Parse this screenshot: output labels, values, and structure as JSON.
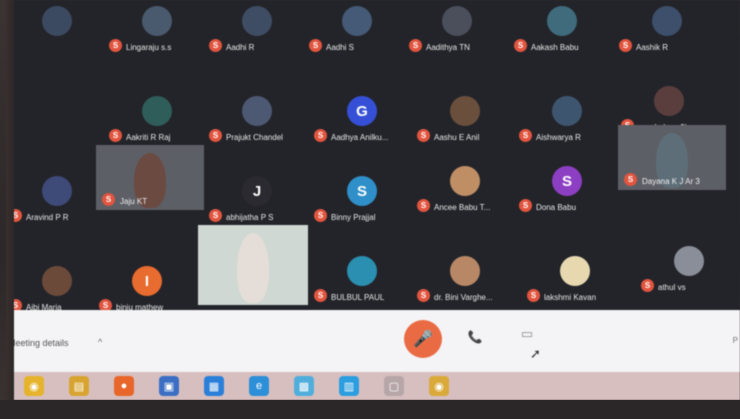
{
  "participants": [
    {
      "name": "Lingaraju s.s",
      "initial": "",
      "avatar_color": "#4a5a6e"
    },
    {
      "name": "Aadhi R",
      "initial": "",
      "avatar_color": "#3e4d63"
    },
    {
      "name": "Aadhi S",
      "initial": "",
      "avatar_color": "#455a76"
    },
    {
      "name": "Aadithya TN",
      "initial": "",
      "avatar_color": "#4b4f5c"
    },
    {
      "name": "Aakash Babu",
      "initial": "",
      "avatar_color": "#3f6b7d"
    },
    {
      "name": "Aashik R",
      "initial": "",
      "avatar_color": "#3d4f6b"
    },
    {
      "name": "",
      "initial": "",
      "avatar_color": "#3b4a60"
    },
    {
      "name": "Aakriti R Raj",
      "initial": "",
      "avatar_color": "#2f5d5a"
    },
    {
      "name": "Prajukt Chandel",
      "initial": "",
      "avatar_color": "#4d5873"
    },
    {
      "name": "Aadhya Anilku...",
      "initial": "G",
      "avatar_color": "#3550d6"
    },
    {
      "name": "Aashu E Anil",
      "initial": "",
      "avatar_color": "#6a4f3c"
    },
    {
      "name": "Aishwarya R",
      "initial": "",
      "avatar_color": "#3e5570"
    },
    {
      "name": "psychology 3b",
      "initial": "",
      "avatar_color": "#5a3e3e"
    },
    {
      "name": "Aravind P R",
      "initial": "",
      "avatar_color": "#3e4a78"
    },
    {
      "name": "Jaju KT",
      "initial": "",
      "avatar_color": "#6b4a42"
    },
    {
      "name": "abhijatha P S",
      "initial": "J",
      "avatar_color": "#2a2a30"
    },
    {
      "name": "Binny Prajjal",
      "initial": "S",
      "avatar_color": "#2f8fc9"
    },
    {
      "name": "Ancee Babu T...",
      "initial": "",
      "avatar_color": "#c08e65"
    },
    {
      "name": "Dona Babu",
      "initial": "S",
      "avatar_color": "#8d3fc4"
    },
    {
      "name": "Dayana K J Ar 3",
      "initial": "",
      "avatar_color": "#5d6e78"
    },
    {
      "name": "Aibi Maria",
      "initial": "",
      "avatar_color": "#6b4a3a"
    },
    {
      "name": "binju mathew",
      "initial": "I",
      "avatar_color": "#e86b2f"
    },
    {
      "name": "",
      "initial": "",
      "avatar_color": "#c8d2cc"
    },
    {
      "name": "BULBUL PAUL",
      "initial": "",
      "avatar_color": "#2a8fb0"
    },
    {
      "name": "dr. Bini Varghe...",
      "initial": "",
      "avatar_color": "#b88866"
    },
    {
      "name": "lakshmi Kavan",
      "initial": "",
      "avatar_color": "#e7d8b0"
    },
    {
      "name": "athul vs",
      "initial": "",
      "avatar_color": "#8a8e98"
    }
  ],
  "controls": {
    "meeting_details": "Meeting details",
    "chevron": "^",
    "mic_icon": "🎤",
    "hangup_icon": "📞",
    "camera_icon": "▭",
    "right_edge_text": "P"
  },
  "taskbar_icons": [
    {
      "name": "chrome-icon",
      "glyph": "◉",
      "color": "#e6b32d"
    },
    {
      "name": "file-explorer-icon",
      "glyph": "▤",
      "color": "#d8a431"
    },
    {
      "name": "firefox-icon",
      "glyph": "●",
      "color": "#e8662a"
    },
    {
      "name": "window-icon",
      "glyph": "▣",
      "color": "#3c6fc4"
    },
    {
      "name": "app-blue-icon",
      "glyph": "▦",
      "color": "#2a7fd8"
    },
    {
      "name": "edge-icon",
      "glyph": "e",
      "color": "#2c8fd8"
    },
    {
      "name": "photos-icon",
      "glyph": "▩",
      "color": "#4faedb"
    },
    {
      "name": "store-icon",
      "glyph": "▥",
      "color": "#2b9ee0"
    },
    {
      "name": "active-window-icon",
      "glyph": "▢",
      "color": "#b7a6a8"
    },
    {
      "name": "chrome-active-icon",
      "glyph": "◉",
      "color": "#d9a93a"
    }
  ]
}
